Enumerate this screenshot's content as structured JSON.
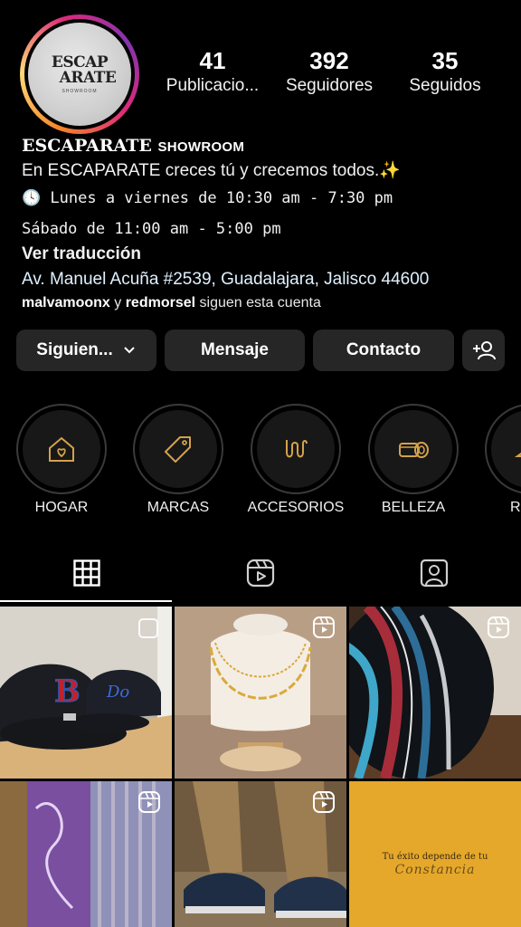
{
  "profile": {
    "logo_line1": "ESCAP",
    "logo_line2": "ARATE",
    "logo_line3": "SHOWROOM",
    "stats": [
      {
        "num": "41",
        "label": "Publicacio..."
      },
      {
        "num": "392",
        "label": "Seguidores"
      },
      {
        "num": "35",
        "label": "Seguidos"
      }
    ]
  },
  "bio": {
    "name": "ESCAPARATE",
    "name_small": "SHOWROOM",
    "line1": "En ESCAPARATE creces tú y crecemos todos.✨",
    "line2_icon": "🕓",
    "line2": "Lunes a viernes de 10:30 am - 7:30 pm",
    "line3": "Sábado de 11:00 am - 5:00 pm",
    "translate": "Ver traducción",
    "address": "Av. Manuel Acuña #2539, Guadalajara, Jalisco 44600",
    "follower1": "malvamoonx",
    "follow_and": " y ",
    "follower2": "redmorsel",
    "follow_tail": " siguen esta cuenta"
  },
  "buttons": {
    "following": "Siguien...",
    "message": "Mensaje",
    "contact": "Contacto"
  },
  "highlights": [
    {
      "label": "HOGAR",
      "icon": "house-heart-icon"
    },
    {
      "label": "MARCAS",
      "icon": "tag-icon"
    },
    {
      "label": "ACCESORIOS",
      "icon": "chain-icon"
    },
    {
      "label": "BELLEZA",
      "icon": "cosmetics-icon"
    },
    {
      "label": "R",
      "icon": "hanger-icon"
    }
  ],
  "tabs": [
    {
      "name": "grid",
      "icon": "grid-icon"
    },
    {
      "name": "reels",
      "icon": "reels-icon"
    },
    {
      "name": "tagged",
      "icon": "tagged-user-icon"
    }
  ],
  "posts": {
    "quote_line1": "Tu éxito depende de tu",
    "quote_line2": "Constancia"
  },
  "colors": {
    "background": "#000000",
    "button": "#262626",
    "highlight_icon": "#d4a24a",
    "quote_bg": "#e5a82b"
  }
}
